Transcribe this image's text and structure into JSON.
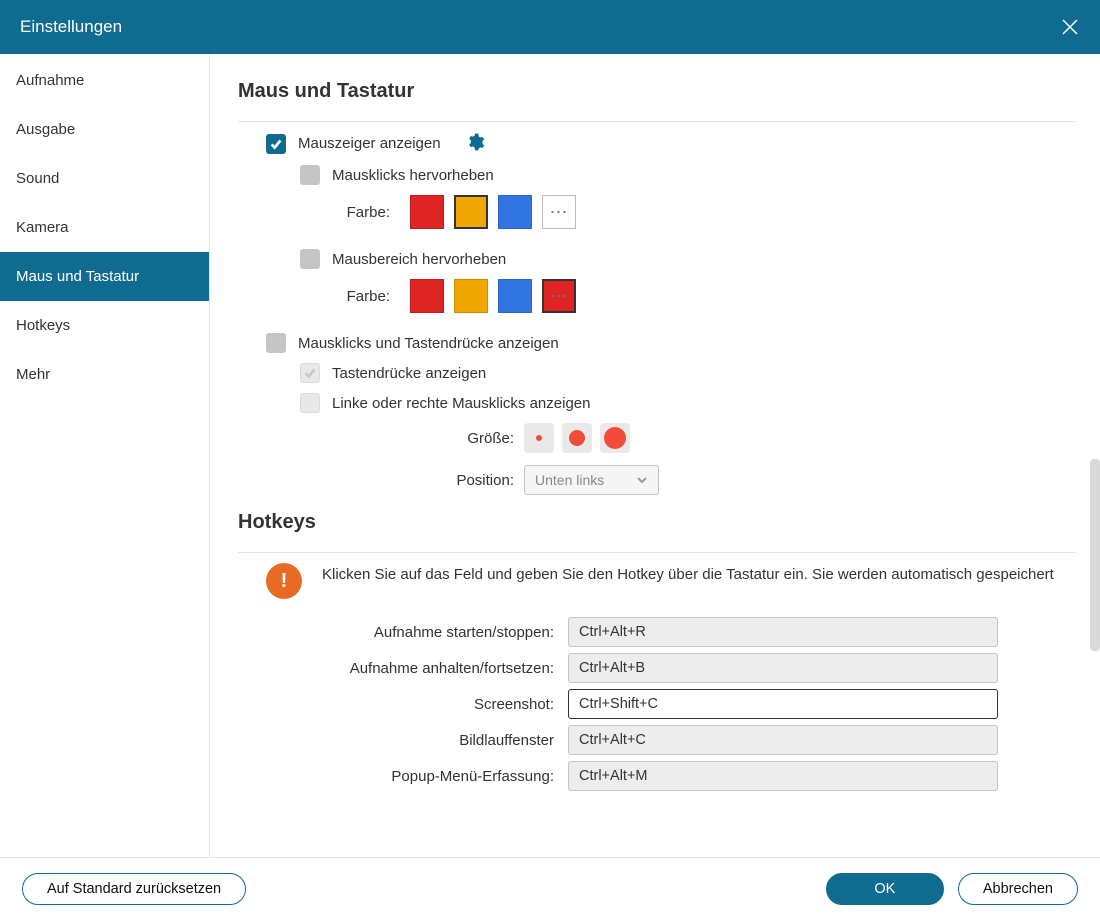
{
  "window": {
    "title": "Einstellungen"
  },
  "sidebar": {
    "items": [
      {
        "label": "Aufnahme"
      },
      {
        "label": "Ausgabe"
      },
      {
        "label": "Sound"
      },
      {
        "label": "Kamera"
      },
      {
        "label": "Maus und Tastatur"
      },
      {
        "label": "Hotkeys"
      },
      {
        "label": "Mehr"
      }
    ],
    "active_index": 4
  },
  "sections": {
    "mouse_keyboard": {
      "title": "Maus und Tastatur",
      "show_cursor": {
        "label": "Mauszeiger anzeigen",
        "checked": true
      },
      "highlight_clicks": {
        "label": "Mausklicks hervorheben",
        "checked": false,
        "color_label": "Farbe:",
        "swatches": [
          "#de2424",
          "#f0a800",
          "#3176e0"
        ],
        "selected_index": 1,
        "more_selected": false
      },
      "highlight_area": {
        "label": "Mausbereich hervorheben",
        "checked": false,
        "color_label": "Farbe:",
        "swatches": [
          "#de2424",
          "#f0a800",
          "#3176e0"
        ],
        "selected_index": null,
        "more_selected": true
      },
      "show_clicks_keys": {
        "label": "Mausklicks und Tastendrücke anzeigen",
        "checked": false
      },
      "show_keystrokes": {
        "label": "Tastendrücke anzeigen",
        "checked": true,
        "disabled": true
      },
      "show_lr_clicks": {
        "label": "Linke oder rechte Mausklicks anzeigen",
        "checked": false,
        "disabled": true
      },
      "size": {
        "label": "Größe:",
        "sizes": [
          6,
          16,
          22
        ]
      },
      "position": {
        "label": "Position:",
        "value": "Unten links"
      }
    },
    "hotkeys": {
      "title": "Hotkeys",
      "info": "Klicken Sie auf das Feld und geben Sie den Hotkey über die Tastatur ein. Sie werden automatisch gespeichert",
      "rows": [
        {
          "label": "Aufnahme starten/stoppen:",
          "value": "Ctrl+Alt+R",
          "active": false
        },
        {
          "label": "Aufnahme anhalten/fortsetzen:",
          "value": "Ctrl+Alt+B",
          "active": false
        },
        {
          "label": "Screenshot:",
          "value": "Ctrl+Shift+C",
          "active": true
        },
        {
          "label": "Bildlauffenster",
          "value": "Ctrl+Alt+C",
          "active": false
        },
        {
          "label": "Popup-Menü-Erfassung:",
          "value": "Ctrl+Alt+M",
          "active": false
        }
      ]
    }
  },
  "footer": {
    "reset": "Auf Standard zurücksetzen",
    "ok": "OK",
    "cancel": "Abbrechen"
  },
  "more_glyph": "⋯"
}
